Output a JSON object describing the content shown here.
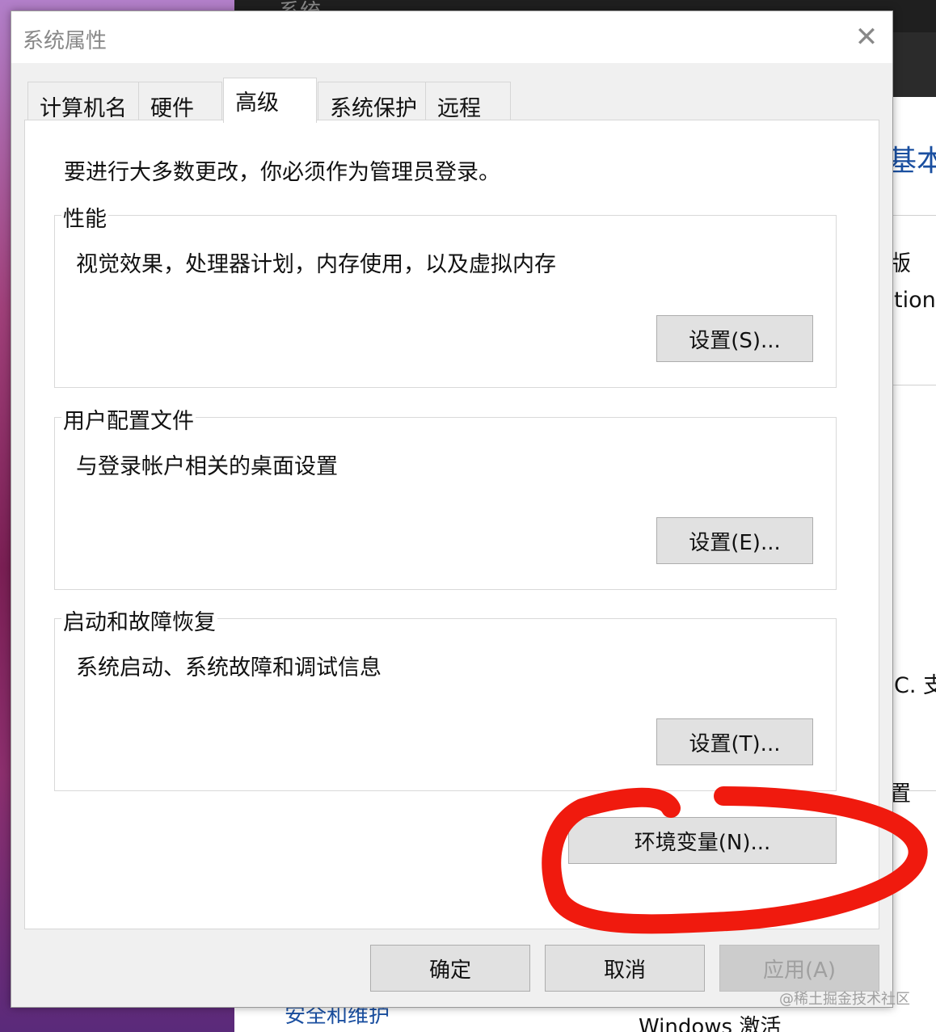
{
  "background": {
    "window_title_fragment": "系统",
    "right_fragments": [
      "基本信",
      "版",
      "tion",
      "C. 支",
      "置"
    ],
    "bottom_fragments": [
      "安全和维护",
      "Windows 激活"
    ]
  },
  "dialog": {
    "title": "系统属性",
    "close_glyph": "✕",
    "tabs": [
      {
        "label": "计算机名",
        "active": false
      },
      {
        "label": "硬件",
        "active": false
      },
      {
        "label": "高级",
        "active": true
      },
      {
        "label": "系统保护",
        "active": false
      },
      {
        "label": "远程",
        "active": false
      }
    ],
    "notice": "要进行大多数更改，你必须作为管理员登录。",
    "groups": [
      {
        "title": "性能",
        "description": "视觉效果，处理器计划，内存使用，以及虚拟内存",
        "button": "设置(S)..."
      },
      {
        "title": "用户配置文件",
        "description": "与登录帐户相关的桌面设置",
        "button": "设置(E)..."
      },
      {
        "title": "启动和故障恢复",
        "description": "系统启动、系统故障和调试信息",
        "button": "设置(T)..."
      }
    ],
    "env_button": "环境变量(N)...",
    "footer": {
      "ok": "确定",
      "cancel": "取消",
      "apply": "应用(A)",
      "apply_enabled": false
    }
  },
  "annotation": {
    "color": "#f01a0e",
    "target": "env-variables-button"
  },
  "watermark": "@稀土掘金技术社区"
}
